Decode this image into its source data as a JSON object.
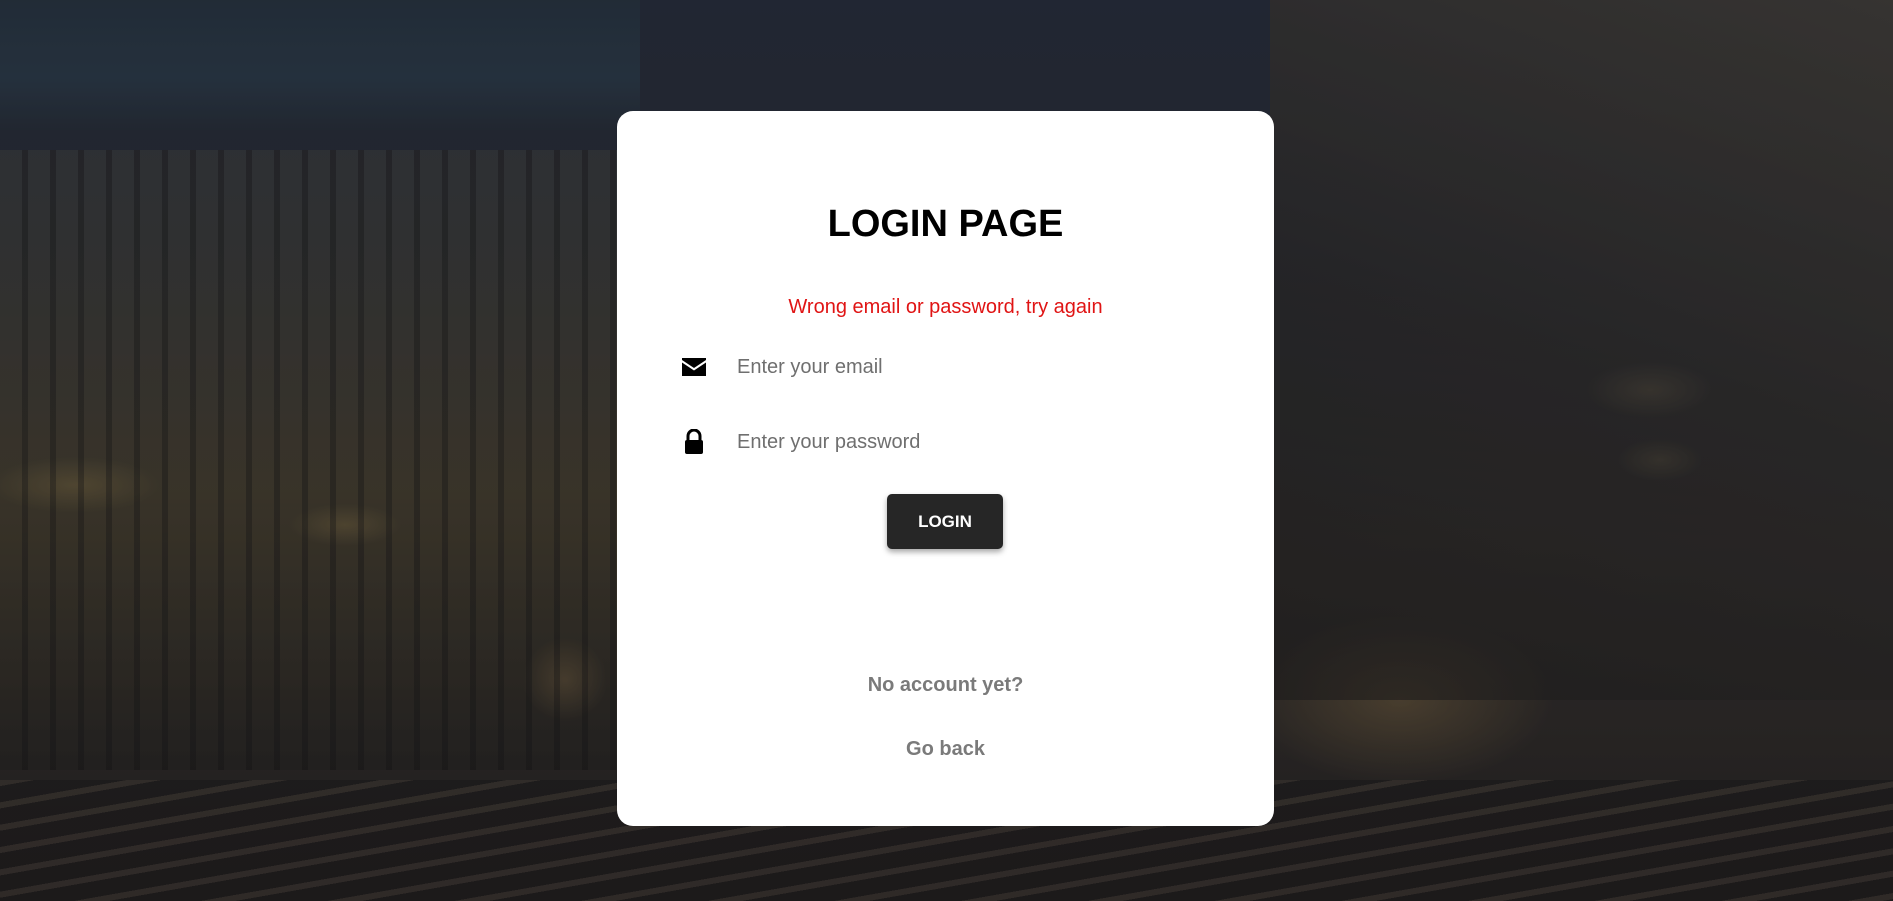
{
  "background": {
    "description_icon": "railway-station-night-photo"
  },
  "login_card": {
    "title": "LOGIN PAGE",
    "error_message": "Wrong email or password, try again",
    "error_color": "#e01414",
    "email": {
      "icon": "envelope-icon",
      "placeholder": "Enter your email",
      "value": ""
    },
    "password": {
      "icon": "lock-icon",
      "placeholder": "Enter your password",
      "value": ""
    },
    "login_button_label": "LOGIN",
    "signup_link": "No account yet?",
    "back_link": "Go back"
  },
  "colors": {
    "button_bg": "#262626",
    "link": "#7a7a7a"
  }
}
